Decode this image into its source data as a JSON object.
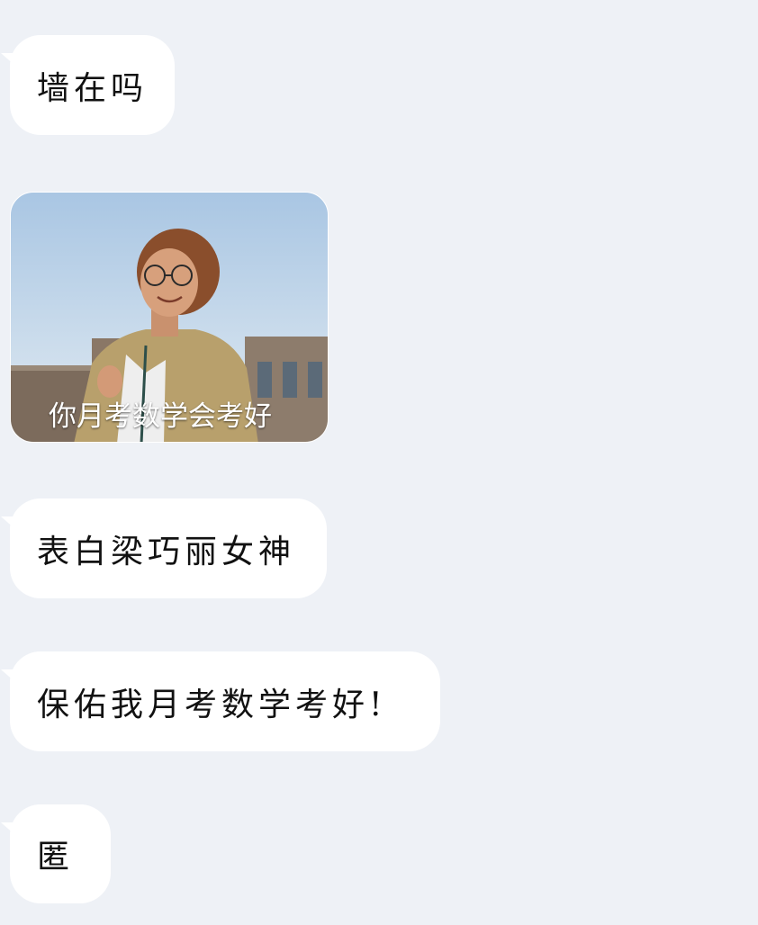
{
  "messages": [
    {
      "type": "text",
      "text": "墙在吗"
    },
    {
      "type": "image",
      "caption": "你月考数学会考好"
    },
    {
      "type": "text",
      "text": "表白梁巧丽女神"
    },
    {
      "type": "text",
      "text": "保佑我月考数学考好!"
    },
    {
      "type": "text",
      "text": "匿"
    }
  ],
  "colors": {
    "background": "#eef1f6",
    "bubble": "#ffffff",
    "text": "#111111",
    "caption": "#ffffff"
  }
}
